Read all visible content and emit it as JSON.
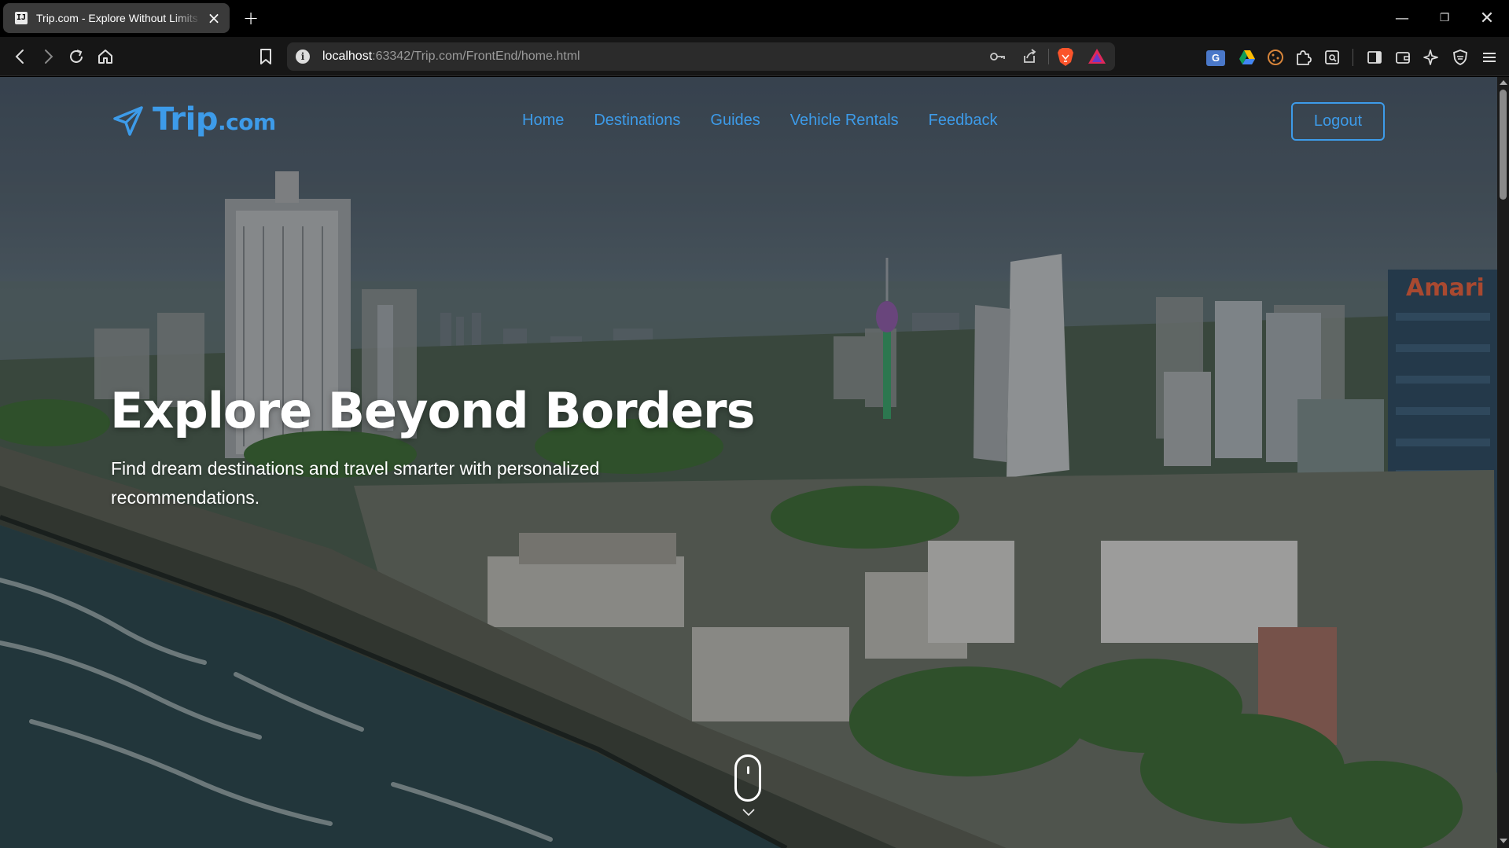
{
  "browser": {
    "tab": {
      "title": "Trip.com - Explore Without Limits",
      "favicon": "intellij-favicon-icon",
      "close": "×"
    },
    "new_tab": "+",
    "window_controls": {
      "minimize": "—",
      "maximize": "❐",
      "close": "✕"
    },
    "nav": {
      "back": "‹",
      "forward": "›",
      "reload": "↻",
      "home": "⌂",
      "bookmark": "🔖"
    },
    "url": {
      "host": "localhost",
      "rest": ":63342/Trip.com/FrontEnd/home.html"
    },
    "url_icons": [
      "key-icon",
      "share-icon",
      "brave-shields-icon",
      "brave-rewards-icon"
    ],
    "extensions": [
      "translate-icon",
      "google-drive-icon",
      "cookie-icon",
      "extensions-puzzle-icon",
      "reader-mode-icon",
      "sidebar-icon",
      "wallet-icon",
      "leo-ai-icon",
      "vpn-shield-icon",
      "menu-icon"
    ]
  },
  "site": {
    "logo": {
      "brand": "Trip",
      "tld": ".com"
    },
    "nav": [
      {
        "label": "Home"
      },
      {
        "label": "Destinations"
      },
      {
        "label": "Guides"
      },
      {
        "label": "Vehicle Rentals"
      },
      {
        "label": "Feedback"
      }
    ],
    "logout_label": "Logout",
    "brand_color": "#3d9be9"
  },
  "hero": {
    "title": "Explore Beyond Borders",
    "subtitle": "Find dream destinations and travel smarter with personalized recommendations.",
    "background": "aerial-city-coastline-photo",
    "building_sign": "Amari",
    "scroll_indicator": "mouse-scroll-icon",
    "scroll_chevron": "⌄"
  }
}
